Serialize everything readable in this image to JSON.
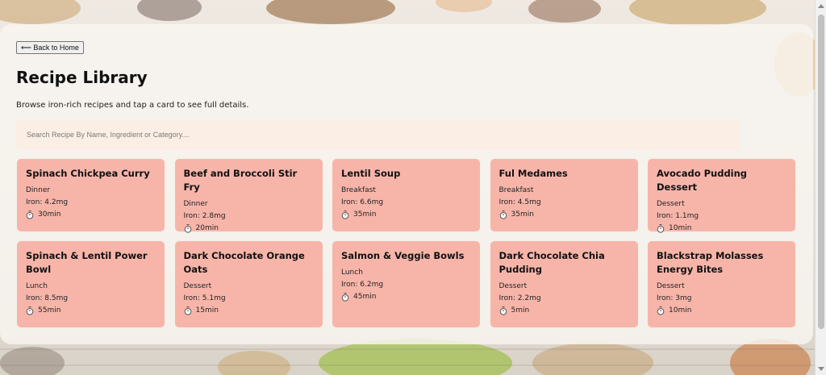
{
  "back_label": "⟵ Back to Home",
  "page_title": "Recipe Library",
  "subtitle": "Browse iron-rich recipes and tap a card to see full details.",
  "search": {
    "placeholder": "Search Recipe By Name, Ingredient or Category....",
    "value": ""
  },
  "colors": {
    "card": "#f7b5aa",
    "panel": "#f8f4f0"
  },
  "recipes": [
    {
      "name": "Spinach Chickpea Curry",
      "category": "Dinner",
      "iron": "Iron: 4.2mg",
      "time": "30min"
    },
    {
      "name": "Beef and Broccoli Stir Fry",
      "category": "Dinner",
      "iron": "Iron: 2.8mg",
      "time": "20min"
    },
    {
      "name": "Lentil Soup",
      "category": "Breakfast",
      "iron": "Iron: 6.6mg",
      "time": "35min"
    },
    {
      "name": "Ful Medames",
      "category": "Breakfast",
      "iron": "Iron: 4.5mg",
      "time": "35min"
    },
    {
      "name": "Avocado Pudding Dessert",
      "category": "Dessert",
      "iron": "Iron: 1.1mg",
      "time": "10min"
    },
    {
      "name": "Spinach & Lentil Power Bowl",
      "category": "Lunch",
      "iron": "Iron: 8.5mg",
      "time": "55min"
    },
    {
      "name": "Dark Chocolate Orange Oats",
      "category": "Dessert",
      "iron": "Iron: 5.1mg",
      "time": "15min"
    },
    {
      "name": "Salmon & Veggie Bowls",
      "category": "Lunch",
      "iron": "Iron: 6.2mg",
      "time": "45min"
    },
    {
      "name": "Dark Chocolate Chia Pudding",
      "category": "Dessert",
      "iron": "Iron: 2.2mg",
      "time": "5min"
    },
    {
      "name": "Blackstrap Molasses Energy Bites",
      "category": "Dessert",
      "iron": "Iron: 3mg",
      "time": "10min"
    }
  ]
}
